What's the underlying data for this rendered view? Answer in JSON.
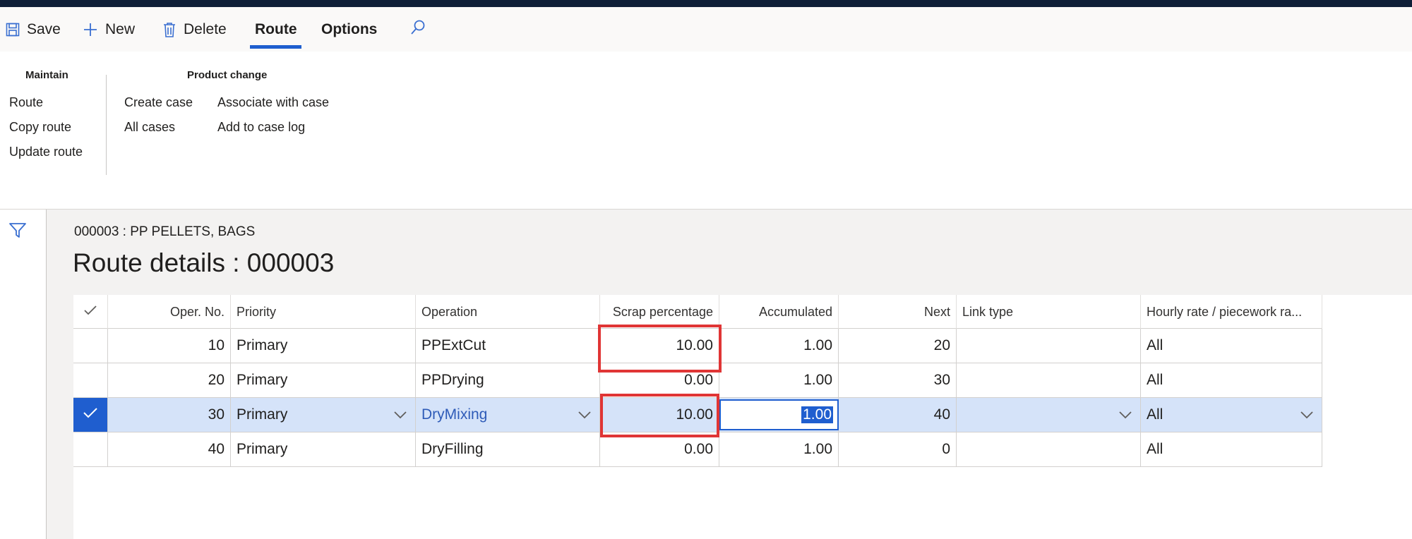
{
  "toolbar": {
    "save": "Save",
    "new": "New",
    "delete": "Delete",
    "tab_route": "Route",
    "tab_options": "Options"
  },
  "ribbon": {
    "maintain": {
      "title": "Maintain",
      "items": [
        "Route",
        "Copy route",
        "Update route"
      ]
    },
    "product_change": {
      "title": "Product change",
      "items": [
        "Create case",
        "All cases",
        "Associate with case",
        "Add to case log"
      ]
    }
  },
  "page": {
    "caption": "000003 : PP PELLETS, BAGS",
    "title": "Route details : 000003"
  },
  "grid": {
    "columns": [
      "Oper. No.",
      "Priority",
      "Operation",
      "Scrap percentage",
      "Accumulated",
      "Next",
      "Link type",
      "Hourly rate / piecework ra..."
    ],
    "rows": [
      {
        "oper_no": "10",
        "priority": "Primary",
        "operation": "PPExtCut",
        "scrap": "10.00",
        "accumulated": "1.00",
        "next": "20",
        "link_type": "",
        "hourly": "All"
      },
      {
        "oper_no": "20",
        "priority": "Primary",
        "operation": "PPDrying",
        "scrap": "0.00",
        "accumulated": "1.00",
        "next": "30",
        "link_type": "",
        "hourly": "All"
      },
      {
        "oper_no": "30",
        "priority": "Primary",
        "operation": "DryMixing",
        "scrap": "10.00",
        "accumulated": "1.00",
        "next": "40",
        "link_type": "",
        "hourly": "All"
      },
      {
        "oper_no": "40",
        "priority": "Primary",
        "operation": "DryFilling",
        "scrap": "0.00",
        "accumulated": "1.00",
        "next": "0",
        "link_type": "",
        "hourly": "All"
      }
    ],
    "selected_row": 2
  },
  "colors": {
    "accent": "#1f5ecf",
    "highlight": "#e03535",
    "selected_row": "#d5e3f9"
  },
  "icons": [
    "save-icon",
    "plus-icon",
    "trash-icon",
    "search-icon",
    "filter-icon",
    "checkmark-icon",
    "chevron-down-icon"
  ]
}
